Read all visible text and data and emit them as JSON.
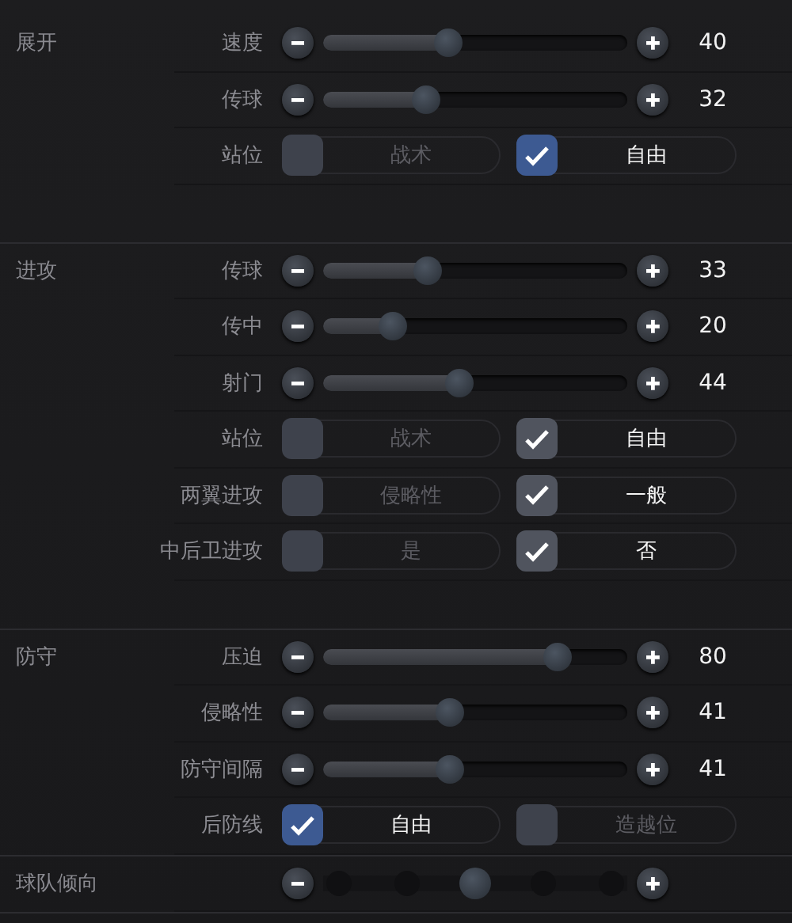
{
  "sections": [
    {
      "title": "展开",
      "rows": [
        {
          "kind": "slider",
          "label": "速度",
          "level": 0.4,
          "value": "40"
        },
        {
          "kind": "slider",
          "label": "传球",
          "level": 0.32,
          "value": "32"
        },
        {
          "kind": "options",
          "label": "站位",
          "highlighted": true,
          "options": [
            {
              "label": "战术",
              "checked": false
            },
            {
              "label": "自由",
              "checked": true
            }
          ]
        }
      ]
    },
    {
      "title": "进攻",
      "rows": [
        {
          "kind": "slider",
          "label": "传球",
          "level": 0.33,
          "value": "33"
        },
        {
          "kind": "slider",
          "label": "传中",
          "level": 0.2,
          "value": "20"
        },
        {
          "kind": "slider",
          "label": "射门",
          "level": 0.44,
          "value": "44"
        },
        {
          "kind": "options",
          "label": "站位",
          "highlighted": false,
          "options": [
            {
              "label": "战术",
              "checked": false
            },
            {
              "label": "自由",
              "checked": true
            }
          ]
        },
        {
          "kind": "options",
          "label": "两翼进攻",
          "highlighted": false,
          "options": [
            {
              "label": "侵略性",
              "checked": false
            },
            {
              "label": "一般",
              "checked": true
            }
          ]
        },
        {
          "kind": "options",
          "label": "中后卫进攻",
          "highlighted": false,
          "options": [
            {
              "label": "是",
              "checked": false
            },
            {
              "label": "否",
              "checked": true
            }
          ]
        }
      ]
    },
    {
      "title": "防守",
      "rows": [
        {
          "kind": "slider",
          "label": "压迫",
          "level": 0.8,
          "value": "80"
        },
        {
          "kind": "slider",
          "label": "侵略性",
          "level": 0.41,
          "value": "41"
        },
        {
          "kind": "slider",
          "label": "防守间隔",
          "level": 0.41,
          "value": "41"
        },
        {
          "kind": "options",
          "label": "后防线",
          "highlighted": true,
          "options": [
            {
              "label": "自由",
              "checked": true
            },
            {
              "label": "造越位",
              "checked": false
            }
          ]
        }
      ]
    },
    {
      "title": "球队倾向",
      "rows": [
        {
          "kind": "stepped",
          "level": 0.5
        }
      ]
    }
  ]
}
